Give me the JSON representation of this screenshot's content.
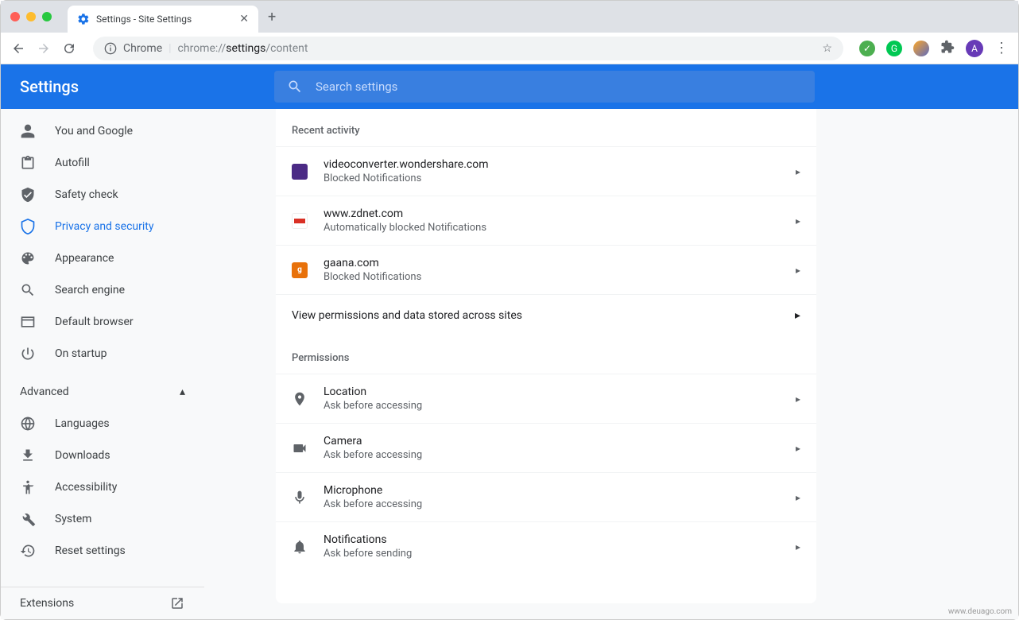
{
  "window": {
    "tab_title": "Settings - Site Settings"
  },
  "toolbar": {
    "chrome_label": "Chrome",
    "url_prefix": "chrome://",
    "url_bold": "settings",
    "url_suffix": "/content",
    "avatar_letter": "A"
  },
  "header": {
    "title": "Settings",
    "search_placeholder": "Search settings"
  },
  "sidebar": {
    "items": [
      {
        "label": "You and Google"
      },
      {
        "label": "Autofill"
      },
      {
        "label": "Safety check"
      },
      {
        "label": "Privacy and security"
      },
      {
        "label": "Appearance"
      },
      {
        "label": "Search engine"
      },
      {
        "label": "Default browser"
      },
      {
        "label": "On startup"
      }
    ],
    "advanced": "Advanced",
    "adv_items": [
      {
        "label": "Languages"
      },
      {
        "label": "Downloads"
      },
      {
        "label": "Accessibility"
      },
      {
        "label": "System"
      },
      {
        "label": "Reset settings"
      }
    ],
    "extensions": "Extensions"
  },
  "main": {
    "recent_title": "Recent activity",
    "recent": [
      {
        "site": "videoconverter.wondershare.com",
        "status": "Blocked Notifications",
        "color": "#4b2a85",
        "letter": ""
      },
      {
        "site": "www.zdnet.com",
        "status": "Automatically blocked Notifications",
        "color": "#d93025",
        "letter": ""
      },
      {
        "site": "gaana.com",
        "status": "Blocked Notifications",
        "color": "#e8710a",
        "letter": "g"
      }
    ],
    "view_all": "View permissions and data stored across sites",
    "perm_title": "Permissions",
    "perms": [
      {
        "name": "Location",
        "status": "Ask before accessing"
      },
      {
        "name": "Camera",
        "status": "Ask before accessing"
      },
      {
        "name": "Microphone",
        "status": "Ask before accessing"
      },
      {
        "name": "Notifications",
        "status": "Ask before sending"
      }
    ]
  },
  "watermark": "www.deuago.com"
}
